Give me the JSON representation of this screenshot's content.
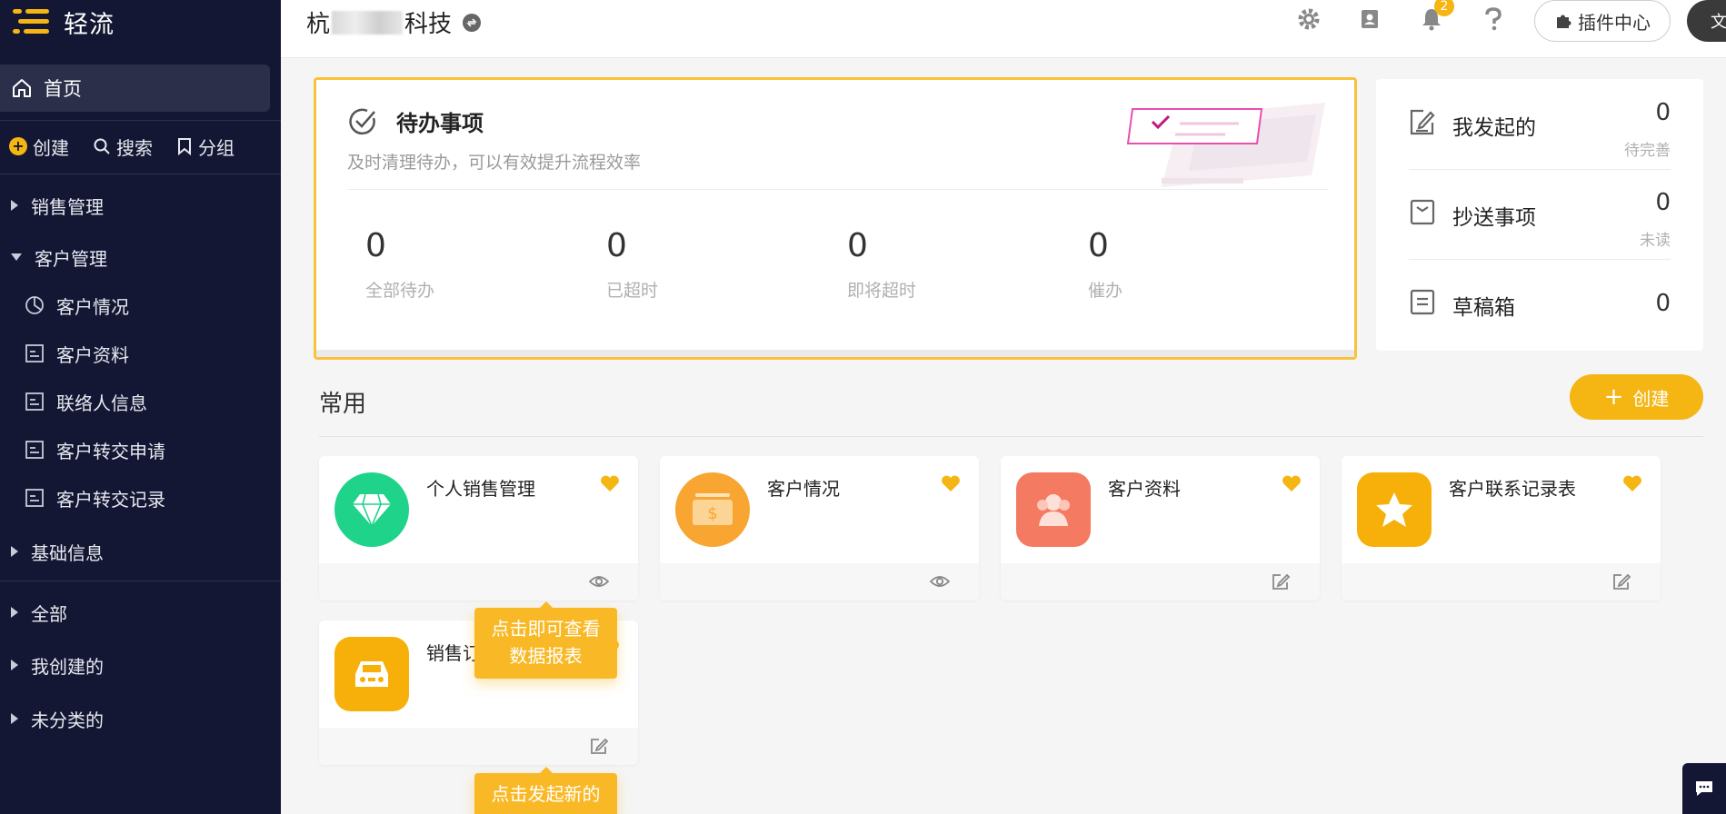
{
  "sidebar": {
    "logo_text": "轻流",
    "home_label": "首页",
    "quick": {
      "create": "创建",
      "search": "搜索",
      "group": "分组"
    },
    "groups": [
      {
        "label": "销售管理",
        "expanded": false
      },
      {
        "label": "客户管理",
        "expanded": true
      },
      {
        "label": "基础信息",
        "expanded": false
      },
      {
        "label": "全部",
        "expanded": false
      },
      {
        "label": "我创建的",
        "expanded": false
      },
      {
        "label": "未分类的",
        "expanded": false
      }
    ],
    "sub_items": [
      "客户情况",
      "客户资料",
      "联络人信息",
      "客户转交申请",
      "客户转交记录"
    ]
  },
  "topbar": {
    "company_prefix": "杭",
    "company_suffix": "科技",
    "notification_count": "2",
    "plugin_label": "插件中心",
    "avatar_text": "文"
  },
  "todo": {
    "title": "待办事项",
    "subtitle": "及时清理待办，可以有效提升流程效率",
    "stats": [
      {
        "value": "0",
        "label": "全部待办"
      },
      {
        "value": "0",
        "label": "已超时"
      },
      {
        "value": "0",
        "label": "即将超时"
      },
      {
        "value": "0",
        "label": "催办"
      }
    ]
  },
  "summary": [
    {
      "label": "我发起的",
      "value": "0",
      "hint": "待完善"
    },
    {
      "label": "抄送事项",
      "value": "0",
      "hint": "未读"
    },
    {
      "label": "草稿箱",
      "value": "0",
      "hint": ""
    }
  ],
  "common": {
    "title": "常用",
    "create_label": "创建",
    "apps": [
      {
        "name": "个人销售管理",
        "icon": "diamond-icon",
        "color": "#1fd38a",
        "action": "eye-icon"
      },
      {
        "name": "客户情况",
        "icon": "wallet-icon",
        "color": "#f8a532",
        "action": "eye-icon"
      },
      {
        "name": "客户资料",
        "icon": "people-icon",
        "color": "#f57a62",
        "action": "edit-icon"
      },
      {
        "name": "客户联系记录表",
        "icon": "star-icon",
        "color": "#f7b00a",
        "action": "edit-icon"
      },
      {
        "name": "销售订",
        "icon": "car-icon",
        "color": "#f7b00a",
        "action": "edit-icon"
      }
    ]
  },
  "tips": {
    "view_report": "点击即可查看数据报表",
    "view_report_line1": "点击即可查看",
    "view_report_line2": "数据报表",
    "start_new": "点击发起新的"
  },
  "colors": {
    "accent": "#f5b512",
    "sidebar_bg": "#131734"
  }
}
